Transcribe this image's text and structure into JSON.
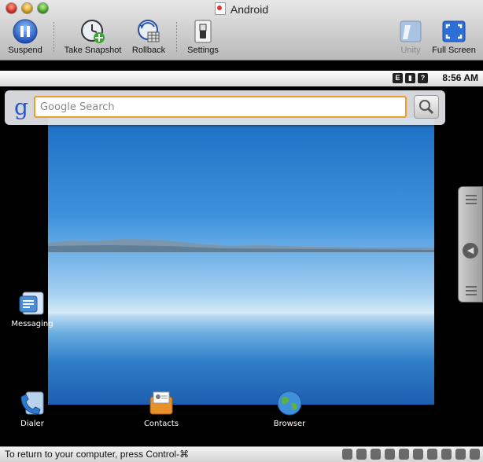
{
  "window": {
    "title": "Android"
  },
  "toolbar": {
    "suspend_label": "Suspend",
    "snapshot_label": "Take Snapshot",
    "rollback_label": "Rollback",
    "settings_label": "Settings",
    "unity_label": "Unity",
    "fullscreen_label": "Full Screen"
  },
  "statusbar": {
    "time": "8:56 AM"
  },
  "search": {
    "logo": "g",
    "placeholder": "Google Search"
  },
  "apps": {
    "messaging": "Messaging",
    "dialer": "Dialer",
    "contacts": "Contacts",
    "browser": "Browser"
  },
  "footer": {
    "message": "To return to your computer, press Control-⌘"
  },
  "colors": {
    "accent": "#f29a26",
    "wallpaper_sky": "#3f93dd",
    "titlebar": "#d2d2d2"
  }
}
